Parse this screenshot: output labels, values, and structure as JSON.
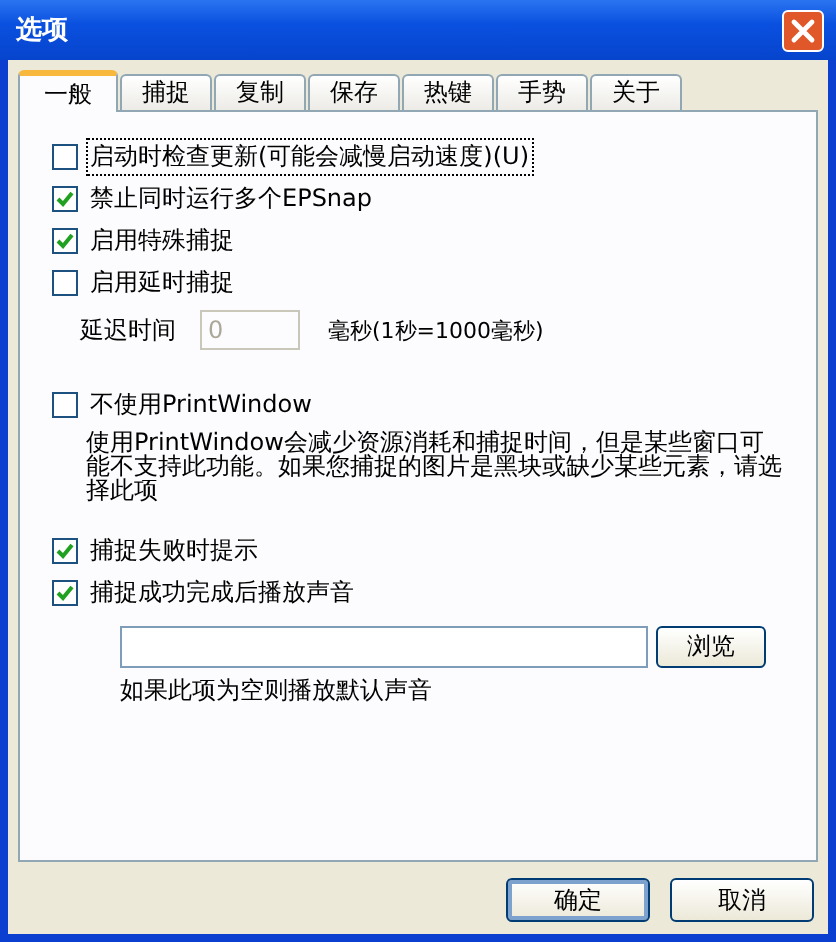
{
  "window": {
    "title": "选项"
  },
  "tabs": [
    {
      "label": "一般",
      "selected": true
    },
    {
      "label": "捕捉",
      "selected": false
    },
    {
      "label": "复制",
      "selected": false
    },
    {
      "label": "保存",
      "selected": false
    },
    {
      "label": "热键",
      "selected": false
    },
    {
      "label": "手势",
      "selected": false
    },
    {
      "label": "关于",
      "selected": false
    }
  ],
  "groups": [
    [
      {
        "kind": "checkbox",
        "label": "启动时检查更新(可能会减慢启动速度)(U)",
        "checked": false,
        "focused": true
      },
      {
        "kind": "checkbox",
        "label": "禁止同时运行多个EPSnap",
        "checked": true,
        "focused": false
      },
      {
        "kind": "checkbox",
        "label": "启用特殊捕捉",
        "checked": true,
        "focused": false
      },
      {
        "kind": "checkbox",
        "label": "启用延时捕捉",
        "checked": false,
        "focused": false
      },
      {
        "kind": "delay",
        "label": "延迟时间",
        "value": "0",
        "disabled": true,
        "unit": "毫秒(1秒=1000毫秒)"
      }
    ],
    [
      {
        "kind": "checkbox",
        "label": "不使用PrintWindow",
        "checked": false,
        "focused": false
      },
      {
        "kind": "description",
        "text": "使用PrintWindow会减少资源消耗和捕捉时间，但是某些窗口可能不支持此功能。如果您捕捉的图片是黑块或缺少某些元素，请选择此项"
      }
    ],
    [
      {
        "kind": "checkbox",
        "label": "捕捉失败时提示",
        "checked": true,
        "focused": false
      },
      {
        "kind": "checkbox",
        "label": "捕捉成功完成后播放声音",
        "checked": true,
        "focused": false
      },
      {
        "kind": "path",
        "button": "浏览"
      },
      {
        "kind": "note",
        "text": "如果此项为空则播放默认声音"
      }
    ]
  ],
  "buttons": [
    {
      "label": "确定",
      "default": true
    },
    {
      "label": "取消",
      "default": false
    }
  ]
}
